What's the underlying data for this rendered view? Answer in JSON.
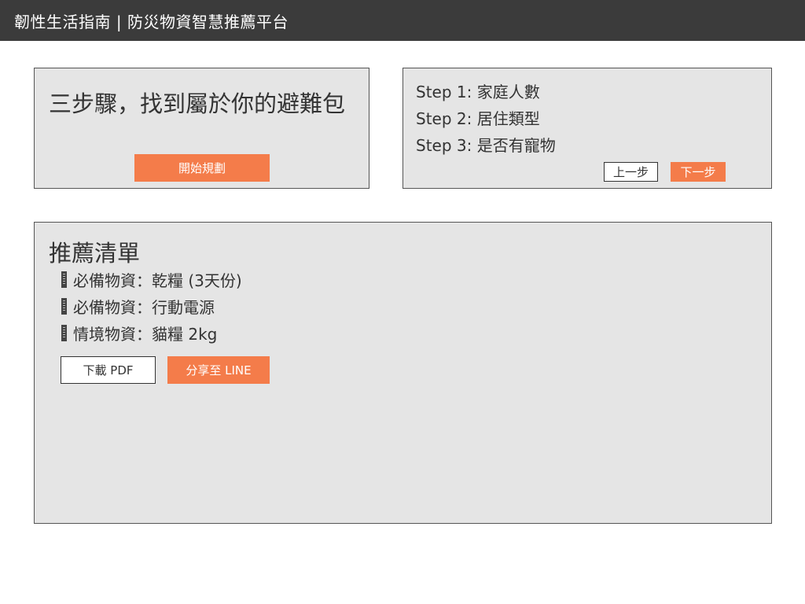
{
  "header": {
    "title": "韌性生活指南 | 防災物資智慧推薦平台"
  },
  "hero": {
    "title": "三步驟，找到屬於你的避難包",
    "start_label": "開始規劃"
  },
  "steps": {
    "items": [
      "Step 1: 家庭人數",
      "Step 2: 居住類型",
      "Step 3: 是否有寵物"
    ],
    "prev_label": "上一步",
    "next_label": "下一步"
  },
  "recommendations": {
    "title": "推薦清單",
    "items": [
      {
        "icon": "document-icon",
        "text": "必備物資：乾糧 (3天份)"
      },
      {
        "icon": "document-icon",
        "text": "必備物資：行動電源"
      },
      {
        "icon": "document-icon",
        "text": "情境物資：貓糧 2kg"
      }
    ],
    "download_label": "下載 PDF",
    "share_label": "分享至 LINE"
  },
  "colors": {
    "header_bg": "#3b3b3b",
    "panel_bg": "#e5e5e5",
    "accent": "#f47c4a"
  }
}
